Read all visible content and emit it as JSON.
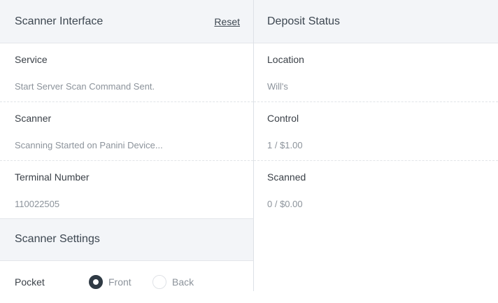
{
  "scanner": {
    "title": "Scanner Interface",
    "reset_label": "Reset",
    "fields": [
      {
        "label": "Service",
        "value": "Start Server Scan Command Sent."
      },
      {
        "label": "Scanner",
        "value": "Scanning Started on Panini Device..."
      },
      {
        "label": "Terminal Number",
        "value": "110022505"
      }
    ]
  },
  "settings": {
    "title": "Scanner Settings",
    "pocket_label": "Pocket",
    "options": [
      {
        "label": "Front",
        "selected": true
      },
      {
        "label": "Back",
        "selected": false
      }
    ]
  },
  "deposit": {
    "title": "Deposit Status",
    "fields": [
      {
        "label": "Location",
        "value": "Will's"
      },
      {
        "label": "Control",
        "value": "1 / $1.00"
      },
      {
        "label": "Scanned",
        "value": "0 / $0.00"
      }
    ]
  },
  "colors": {
    "header_bg": "#f3f5f8",
    "radio_selected": "#2f3a44"
  }
}
